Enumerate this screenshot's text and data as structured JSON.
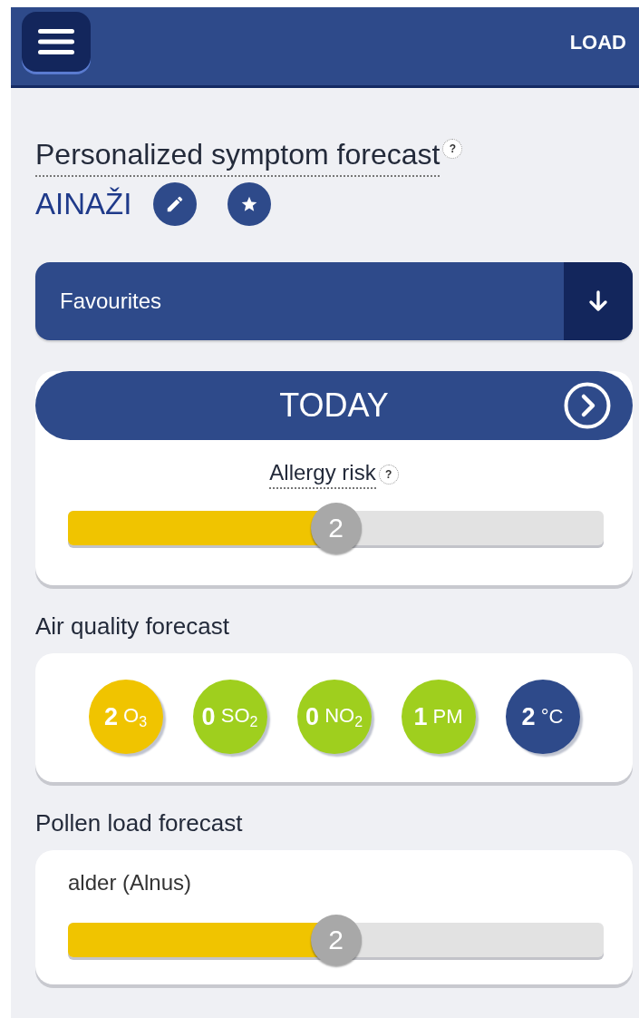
{
  "header": {
    "load_label": "LOAD"
  },
  "title": {
    "text": "Personalized symptom forecast",
    "help": "?"
  },
  "location": {
    "name": "AINAŽI"
  },
  "favourites": {
    "label": "Favourites"
  },
  "today": {
    "title": "TODAY",
    "risk_label": "Allergy risk",
    "help": "?",
    "level": 0.5,
    "reading": "2"
  },
  "air_quality": {
    "title": "Air quality forecast",
    "items": [
      {
        "value": "2",
        "unit": "O$_{3}$",
        "color": "#f0c400"
      },
      {
        "value": "0",
        "unit": "SO$_{2}$",
        "color": "#9fcf1e"
      },
      {
        "value": "0",
        "unit": "NO$_{2}$",
        "color": "#9fcf1e"
      },
      {
        "value": "1",
        "unit": "PM",
        "color": "#9fcf1e"
      },
      {
        "value": "2",
        "unit": "°C",
        "color": "#2e4a8a"
      }
    ]
  },
  "pollen": {
    "title": "Pollen load forecast",
    "items": [
      {
        "name": "alder (Alnus)",
        "level": 0.5,
        "reading": "2"
      }
    ]
  }
}
